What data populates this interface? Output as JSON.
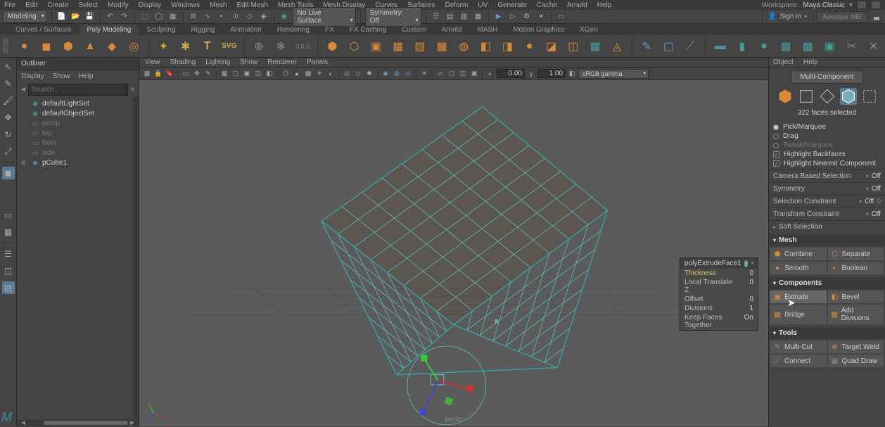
{
  "menubar": [
    "File",
    "Edit",
    "Create",
    "Select",
    "Modify",
    "Display",
    "Windows",
    "Mesh",
    "Edit Mesh",
    "Mesh Tools",
    "Mesh Display",
    "Curves",
    "Surfaces",
    "Deform",
    "UV",
    "Generate",
    "Cache",
    "Arnold",
    "Help"
  ],
  "workspace": {
    "label": "Workspace:",
    "value": "Maya Classic"
  },
  "toolrow1": {
    "mode": "Modeling",
    "noLiveSurface": "No Live Surface",
    "symmetry": "Symmetry: Off",
    "signin": "Sign in",
    "logo": "Autodesk MEI"
  },
  "moduleTabs": [
    "Curves / Surfaces",
    "Poly Modeling",
    "Sculpting",
    "Rigging",
    "Animation",
    "Rendering",
    "FX",
    "FX Caching",
    "Custom",
    "Arnold",
    "MASH",
    "Motion Graphics",
    "XGen"
  ],
  "moduleActive": "Poly Modeling",
  "outliner": {
    "title": "Outliner",
    "menu": [
      "Display",
      "Show",
      "Help"
    ],
    "searchPlaceholder": "Search..",
    "items": [
      {
        "label": "defaultLightSet",
        "type": "set",
        "dim": false
      },
      {
        "label": "defaultObjectSet",
        "type": "set",
        "dim": false
      },
      {
        "label": "persp",
        "type": "cam",
        "dim": true
      },
      {
        "label": "top",
        "type": "cam",
        "dim": true
      },
      {
        "label": "front",
        "type": "cam",
        "dim": true
      },
      {
        "label": "side",
        "type": "cam",
        "dim": true
      },
      {
        "label": "pCube1",
        "type": "mesh",
        "dim": false,
        "expand": true
      }
    ]
  },
  "viewport": {
    "menu": [
      "View",
      "Shading",
      "Lighting",
      "Show",
      "Renderer",
      "Panels"
    ],
    "exposure": "0.00",
    "gamma": "1.00",
    "colorspace": "sRGB gamma",
    "perspLabel": "persp"
  },
  "attrPanel": {
    "title": "polyExtrudeFace1",
    "rows": [
      {
        "label": "Thickness",
        "val": "0",
        "hl": true
      },
      {
        "label": "Local Translate Z",
        "val": "0"
      },
      {
        "label": "Offset",
        "val": "0"
      },
      {
        "label": "Divisions",
        "val": "1"
      },
      {
        "label": "Keep Faces Together",
        "val": "On"
      }
    ]
  },
  "rightPanel": {
    "menu": [
      "Object",
      "Help"
    ],
    "multiComponent": "Multi-Component",
    "selCount": "322 faces selected",
    "selectModes": [
      {
        "label": "Pick/Marquee",
        "on": true
      },
      {
        "label": "Drag",
        "on": false
      },
      {
        "label": "Tweak/Marquee",
        "on": false,
        "dim": true
      }
    ],
    "highlights": [
      {
        "label": "Highlight Backfaces",
        "on": true
      },
      {
        "label": "Highlight Nearest Component",
        "on": true
      }
    ],
    "settings": [
      {
        "label": "Camera Based Selection",
        "val": "Off"
      },
      {
        "label": "Symmetry",
        "val": "Off"
      },
      {
        "label": "Selection Constraint",
        "val": "Off",
        "count": "0"
      },
      {
        "label": "Transform Constraint",
        "val": "Off"
      }
    ],
    "softSel": "Soft Selection",
    "sections": {
      "mesh": {
        "title": "Mesh",
        "btns": [
          "Combine",
          "Separate",
          "Smooth",
          "Boolean"
        ]
      },
      "components": {
        "title": "Components",
        "btns": [
          "Extrude",
          "Bevel",
          "Bridge",
          "Add Divisions"
        ]
      },
      "tools": {
        "title": "Tools",
        "btns": [
          "Multi-Cut",
          "Target Weld",
          "Connect",
          "Quad Draw"
        ]
      }
    }
  }
}
